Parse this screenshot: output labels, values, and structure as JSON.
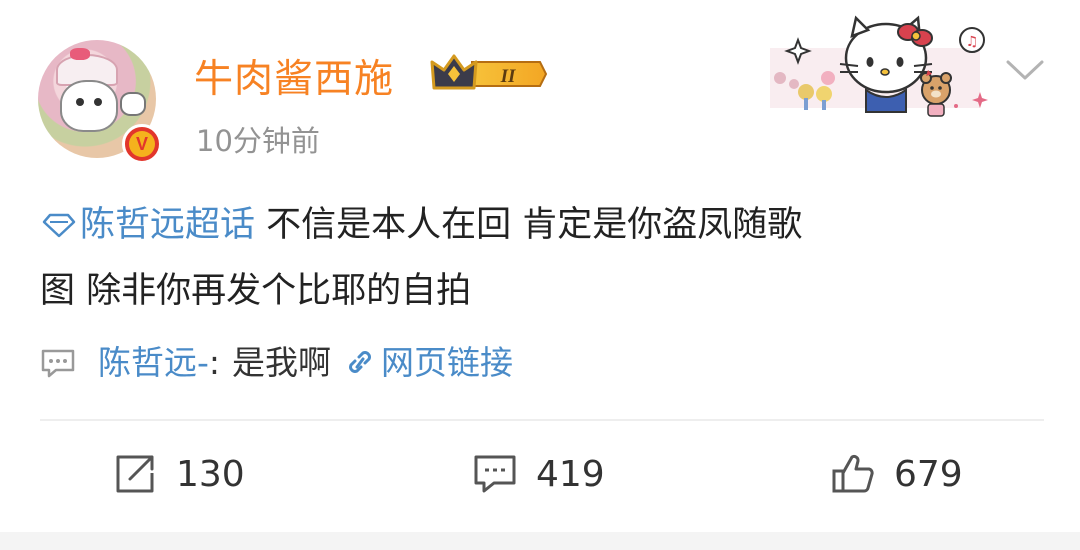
{
  "header": {
    "username": "牛肉酱西施",
    "member_level": "II",
    "timestamp": "10分钟前"
  },
  "post": {
    "topic": "陈哲远超话",
    "text_line1": " 不信是本人在回 肯定是你盗凤随歌",
    "text_line2": "图 除非你再发个比耶的自拍"
  },
  "hot_comment": {
    "author": "陈哲远-",
    "separator": ":",
    "body": "是我啊",
    "link_label": "网页链接"
  },
  "actions": {
    "repost_count": "130",
    "comment_count": "419",
    "like_count": "679"
  },
  "colors": {
    "username": "#f78223",
    "link": "#4a8bc8",
    "timestamp": "#939393",
    "text": "#222222"
  },
  "icons": [
    "avatar",
    "verified-v-icon",
    "crown-badge-icon",
    "chevron-down-icon",
    "topic-diamond-icon",
    "comment-bubble-icon",
    "link-icon",
    "repost-icon",
    "comment-icon",
    "like-thumb-icon"
  ]
}
